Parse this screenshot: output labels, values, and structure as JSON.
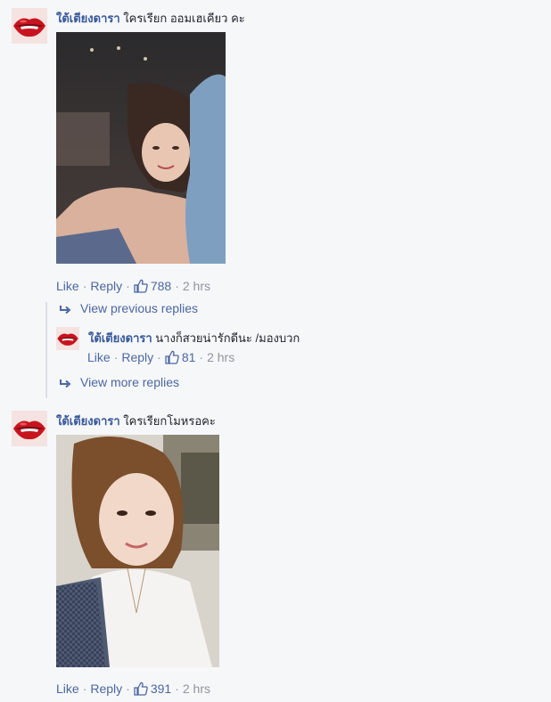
{
  "comments": [
    {
      "author": "ใต้เตียงดารา",
      "text": "ใครเรียก ออมเฮเคียว คะ",
      "like": "Like",
      "reply": "Reply",
      "likes": "788",
      "time": "2 hrs"
    },
    {
      "author": "ใต้เตียงดารา",
      "text": "ใครเรียกโมหรอคะ",
      "like": "Like",
      "reply": "Reply",
      "likes": "391",
      "time": "2 hrs"
    }
  ],
  "thread": {
    "view_previous": "View previous replies",
    "view_more": "View more replies",
    "reply": {
      "author": "ใต้เตียงดารา",
      "text": "นางก็สวยน่ารักดีนะ /มองบวก",
      "like": "Like",
      "reply": "Reply",
      "likes": "81",
      "time": "2 hrs"
    }
  },
  "icons": {
    "avatar": "red-lips-avatar",
    "like": "thumbs-up-icon",
    "reply_arrow": "reply-arrow-icon"
  },
  "colors": {
    "link": "#4b67a1",
    "author": "#365899",
    "meta": "#90949c",
    "background": "#f6f7f9"
  }
}
